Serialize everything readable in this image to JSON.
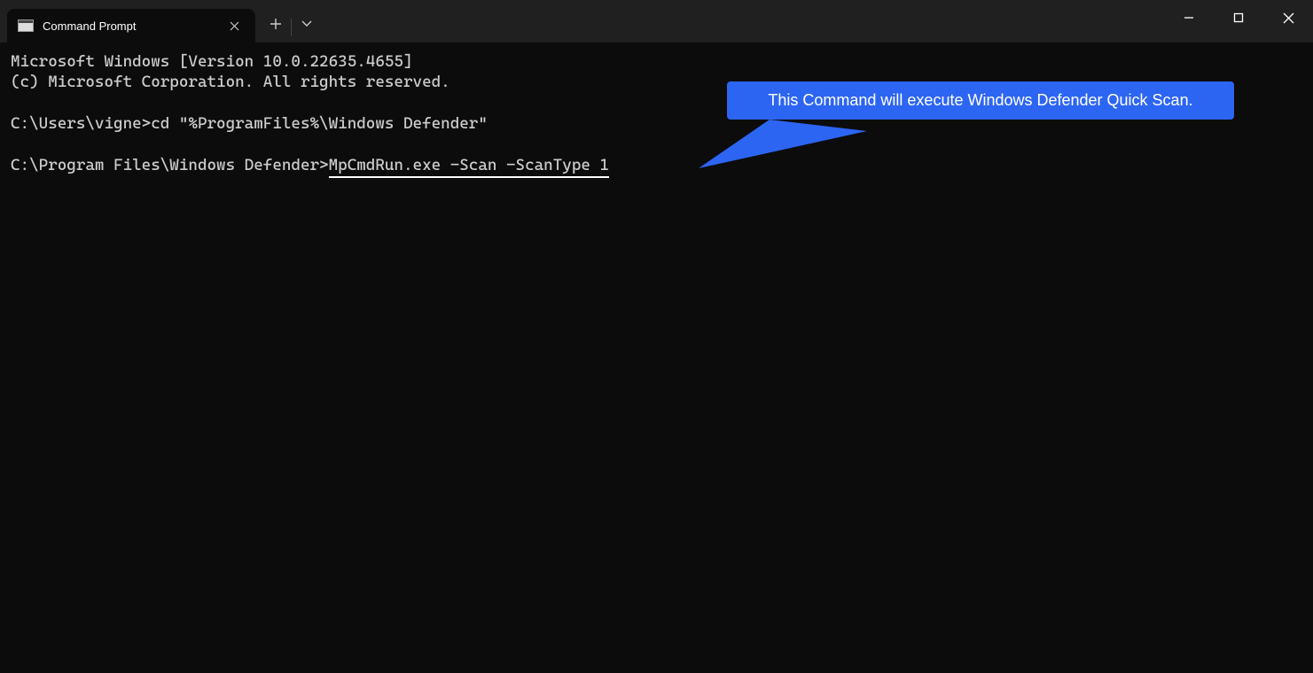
{
  "tab": {
    "title": "Command Prompt"
  },
  "terminal": {
    "line1": "Microsoft Windows [Version 10.0.22635.4655]",
    "line2": "(c) Microsoft Corporation. All rights reserved.",
    "prompt1": "C:\\Users\\vigne>",
    "cmd1": "cd \"%ProgramFiles%\\Windows Defender\"",
    "prompt2": "C:\\Program Files\\Windows Defender>",
    "cmd2": "MpCmdRun.exe -Scan -ScanType 1"
  },
  "callout": {
    "text": "This Command will execute Windows Defender Quick Scan."
  }
}
